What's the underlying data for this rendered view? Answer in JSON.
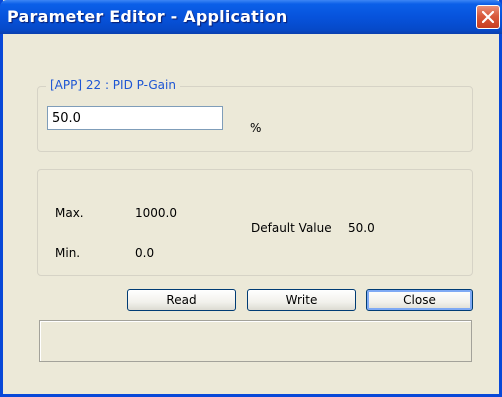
{
  "window": {
    "title": "Parameter Editor - Application",
    "colors": {
      "titlebar": "#0753dc",
      "frame": "#0848d8",
      "body": "#ece9d8",
      "close": "#d95a3c",
      "legend": "#1e56d4"
    }
  },
  "parameter": {
    "legend": "[APP] 22 : PID P-Gain",
    "value": "50.0",
    "unit": "%"
  },
  "info": {
    "max_label": "Max.",
    "max_value": "1000.0",
    "min_label": "Min.",
    "min_value": "0.0",
    "default_label": "Default Value",
    "default_value": "50.0"
  },
  "buttons": {
    "read": "Read",
    "write": "Write",
    "close": "Close"
  },
  "icons": {
    "close": "close-icon"
  }
}
